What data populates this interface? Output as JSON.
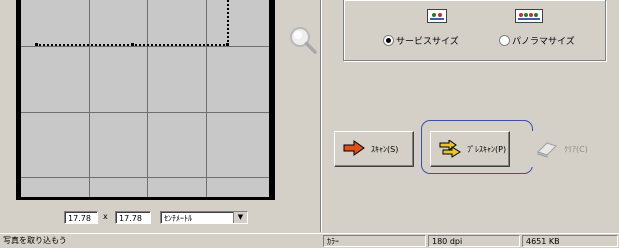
{
  "size_options": {
    "selected": "service",
    "service_label": "サービスサイズ",
    "panorama_label": "パノラマサイズ"
  },
  "buttons": {
    "scan_label": "ｽｷｬﾝ(S)",
    "prescan_label": "ﾌﾟﾚｽｷｬﾝ(P)",
    "clear_label": "ｸﾘｱ(C)"
  },
  "dimensions": {
    "width": "17.78",
    "height": "17.78",
    "separator": "x",
    "unit": "ｾﾝﾁﾒｰﾄﾙ"
  },
  "status_bar": {
    "message": "写真を取り込もう",
    "color_mode": "ｶﾗｰ",
    "resolution": "180 dpi",
    "file_size": "4651 KB"
  },
  "icons": {
    "zoom": "magnifier-icon",
    "scan": "arrow-right-icon",
    "prescan": "double-arrow-icon",
    "clear": "eraser-icon",
    "unit_dropdown": "chevron-down-icon"
  },
  "colors": {
    "dialog_bg": "#d4d0c8",
    "preview_bg": "#c8c8c8",
    "highlight_ring": "#3e4fa8",
    "scan_arrow": "#e0501a",
    "prescan_arrow": "#e8c430"
  }
}
